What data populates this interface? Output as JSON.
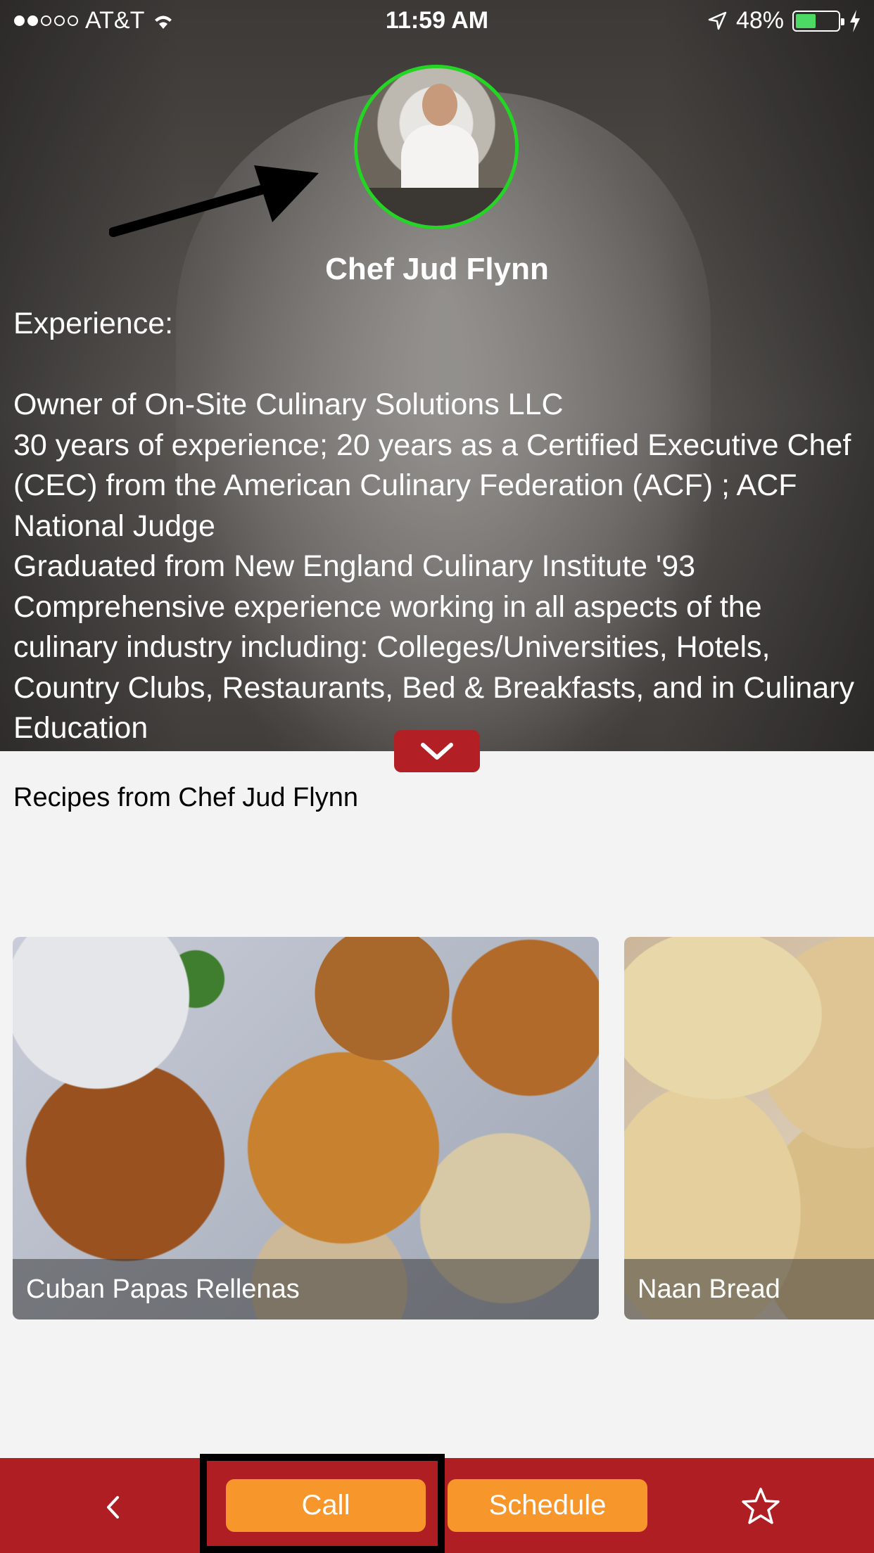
{
  "status_bar": {
    "carrier": "AT&T",
    "time": "11:59 AM",
    "battery_percent": "48%",
    "battery_level": 0.48,
    "battery_color": "#4cd964"
  },
  "profile": {
    "name": "Chef Jud Flynn",
    "avatar_ring_color": "#24d524",
    "bio": "Experience:\n\nOwner of On-Site Culinary Solutions LLC\n30 years of experience; 20 years as a Certified Executive Chef (CEC) from the American Culinary Federation (ACF) ; ACF National Judge\nGraduated from New England Culinary Institute '93\nComprehensive experience working in all aspects of the culinary industry including: Colleges/Universities, Hotels, Country Clubs, Restaurants, Bed & Breakfasts, and in Culinary Education"
  },
  "icons": {
    "expand": "chevron-down-icon",
    "back": "chevron-left-icon",
    "favorite": "star-icon",
    "annotation": "arrow-icon"
  },
  "recipes": {
    "title": "Recipes from Chef Jud Flynn",
    "items": [
      {
        "name": "Cuban Papas Rellenas"
      },
      {
        "name": "Naan Bread"
      }
    ]
  },
  "toolbar": {
    "call_label": "Call",
    "schedule_label": "Schedule",
    "bar_color": "#ae1e22",
    "button_color": "#f7962b"
  }
}
